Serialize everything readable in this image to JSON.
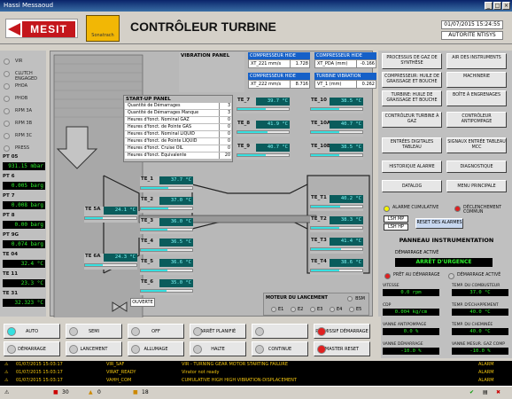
{
  "window": {
    "title": "Hassi Messaoud"
  },
  "header": {
    "logo_text": "MESIT",
    "logo2_text": "Sonatrach",
    "title": "CONTRÔLEUR TURBINE",
    "datetime": "01/07/2015 15:24:55",
    "user": "AUTORITE NTISYS"
  },
  "left_indicators": [
    {
      "label": "VIR"
    },
    {
      "label": "CLUTCH ENGAGED"
    },
    {
      "label": "PHOA"
    },
    {
      "label": "PHOB"
    },
    {
      "label": "RPM 3A"
    },
    {
      "label": "RPM 3B"
    },
    {
      "label": "RPM 3C"
    },
    {
      "label": "PRESS"
    }
  ],
  "pressures": [
    {
      "label": "PT 05",
      "value": "931.15 mbar"
    },
    {
      "label": "PT 6",
      "value": "0.005 barg"
    },
    {
      "label": "PT 7",
      "value": "0.008 barg"
    },
    {
      "label": "PT 8",
      "value": "0.00 barg"
    },
    {
      "label": "PT 9G",
      "value": "0.074 barg"
    },
    {
      "label": "TE 04",
      "value": "32.4 °C"
    },
    {
      "label": "TE 11",
      "value": "23.3 °C"
    },
    {
      "label": "TE 31",
      "value": "32.323 °C"
    }
  ],
  "vibration_panel": {
    "title": "VIBRATION PANEL",
    "items": [
      {
        "header": "COMPRESSEUR HIDE",
        "tag": "XT_221 mm/s",
        "value": "1.728"
      },
      {
        "header": "COMPRESSEUR HIDE",
        "tag": "XT_PDA (mm)",
        "value": "-0.166"
      },
      {
        "header": "COMPRESSEUR HIDE",
        "tag": "XT_222 mm/s",
        "value": "8.716"
      },
      {
        "header": "TURBINE VIBRATION",
        "tag": "VT_1 (mm)",
        "value": "0.262"
      }
    ]
  },
  "startup_panel": {
    "title": "START-UP PANEL",
    "rows": [
      {
        "label": "Quantité de Démarrages",
        "value": "3"
      },
      {
        "label": "Quantité de Démarrages Manque",
        "value": "3"
      },
      {
        "label": "Heures d'fonct. Nominal GAZ",
        "value": "0"
      },
      {
        "label": "Heures d'fonct. de Pointe GAS",
        "value": "0"
      },
      {
        "label": "Heures d'fonct. Nominal LIQUID",
        "value": "0"
      },
      {
        "label": "Heures d'fonct. de Pointe LIQUID",
        "value": "0"
      },
      {
        "label": "Heures d'fonct. Cruise OIL",
        "value": "0"
      },
      {
        "label": "Heures d'fonct. Equivalente",
        "value": "20"
      }
    ]
  },
  "temperatures": [
    {
      "label": "TE_7",
      "value": "39.7 °C",
      "fill": 0.55
    },
    {
      "label": "TE_10",
      "value": "38.5 °C",
      "fill": 0.55
    },
    {
      "label": "TE_8",
      "value": "41.9 °C",
      "fill": 0.58
    },
    {
      "label": "TE_10A",
      "value": "40.7 °C",
      "fill": 0.56
    },
    {
      "label": "TE_9",
      "value": "40.7 °C",
      "fill": 0.56
    },
    {
      "label": "TE_10B",
      "value": "38.5 °C",
      "fill": 0.55
    },
    {
      "label": "TE_1",
      "value": "37.7 °C",
      "fill": 0.54
    },
    {
      "label": "TE_2",
      "value": "37.0 °C",
      "fill": 0.53
    },
    {
      "label": "TE_3",
      "value": "36.0 °C",
      "fill": 0.52
    },
    {
      "label": "TE_4",
      "value": "36.5 °C",
      "fill": 0.52
    },
    {
      "label": "TE_5",
      "value": "36.6 °C",
      "fill": 0.52
    },
    {
      "label": "TE_6",
      "value": "35.0 °C",
      "fill": 0.5
    },
    {
      "label": "TE 5A",
      "value": "24.1 °C",
      "fill": 0.35
    },
    {
      "label": "TE 6A",
      "value": "24.3 °C",
      "fill": 0.35
    },
    {
      "label": "TE_T1",
      "value": "40.2 °C",
      "fill": 0.57
    },
    {
      "label": "TE_T2",
      "value": "38.3 °C",
      "fill": 0.55
    },
    {
      "label": "TE_T3",
      "value": "41.4 °C",
      "fill": 0.58
    },
    {
      "label": "TE_T4",
      "value": "38.6 °C",
      "fill": 0.55
    }
  ],
  "machine": {
    "ouverte": "OUVERTE",
    "moteur_title": "MOTEUR DU LANCEMENT",
    "moteur_items": [
      "E1",
      "E2",
      "E3",
      "E4",
      "E5"
    ],
    "bsm": "BSM"
  },
  "nav_buttons": [
    "PROCESSUS DE GAZ DE SYNTHÈSE",
    "AIR DES INSTRUMENTS",
    "COMPRESSEUR: HUILE DE GRAISSAGE ET BOUCHE",
    "MACHINERIE",
    "TURBINE: HUILE DE GRAISSAGE ET BOUCHE",
    "BOÎTE À ENGRENAGES",
    "CONTRÔLEUR TURBINE À GAZ",
    "CONTRÔLEUR ANTIPOMPAGE",
    "ENTRÉES DIGITALES TABLEAU",
    "SIGNAUX ENTRÉE TABLEAU MCC",
    "HISTORIQUE ALARME",
    "DIAGNOSTIQUE",
    "DATALOG",
    "MENU PRINCIPALE"
  ],
  "alarm_indicators": {
    "cumulative": "ALARME CUMULATIVE",
    "declenchement": "DÉCLENCHEMENT COMMUN",
    "lsh_mp": "LSH MP",
    "lsh_hp": "LSH HP",
    "reset": "RESET DES ALARMES"
  },
  "instrument_panel": {
    "title": "PANNEAU INSTRUMENTATION",
    "startup_label": "DÉMARRAGE ACTIVÉ",
    "startup_state": "ARRÊT D'URGENCE",
    "pret": "PRÊT AU DÉMARRAGE",
    "demarrage_active": "DÉMARRAGE ACTIVÉ",
    "readings": [
      {
        "label": "VITESSE",
        "value": "0.0 rpm"
      },
      {
        "label": "TEMP. DU COMBUSTEUR",
        "value": "37.0 °C"
      },
      {
        "label": "CDP",
        "value": "0.004 kg/cm"
      },
      {
        "label": "TEMP. D'ÉCHAPPEMENT",
        "value": "40.0 °C"
      },
      {
        "label": "VANNE ANTIPOMPAGE",
        "value": "0.0 %"
      },
      {
        "label": "TEMP. DU CHEMINÉE",
        "value": "40.0 °C"
      },
      {
        "label": "VANNE DÉMARRAGE",
        "value": "-10.0 %"
      },
      {
        "label": "VANNE MESUR. GAZ COMP",
        "value": "-10.0 %"
      }
    ]
  },
  "bottom_buttons": [
    {
      "label": "AUTO",
      "led": "#35e0e0"
    },
    {
      "label": "SEMI",
      "led": "#c8c8c8"
    },
    {
      "label": "OFF",
      "led": "#c8c8c8"
    },
    {
      "label": "ARRÊT PLANIFIÉ",
      "led": "#c8c8c8"
    },
    {
      "label": "",
      "led": "#c8c8c8"
    },
    {
      "label": "PERMISSIF DÉMARRAGE",
      "led": "#e02020"
    },
    {
      "label": "DÉMARRAGE",
      "led": "#c8c8c8"
    },
    {
      "label": "LANCEMENT",
      "led": "#c8c8c8"
    },
    {
      "label": "ALLUMAGE",
      "led": "#c8c8c8"
    },
    {
      "label": "HALTE",
      "led": "#c8c8c8"
    },
    {
      "label": "CONTINUE",
      "led": "#c8c8c8"
    },
    {
      "label": "MASTER RESET",
      "led": "#e02020"
    }
  ],
  "alarm_log": [
    {
      "time": "01/07/2015 15:03:17",
      "tag": "VIR_SAF",
      "msg": "VIR - TURNING GEAR MOTOR STARTING FAILURE",
      "type": "ALARM"
    },
    {
      "time": "01/07/2015 15:03:17",
      "tag": "VIRAT_READY",
      "msg": "Virator not ready",
      "type": "ALARM"
    },
    {
      "time": "01/07/2015 15:03:17",
      "tag": "VAHH_COM",
      "msg": "CUMULATIVE HIGH HIGH VIBRATION-DISPLACEMENT",
      "type": "ALARM"
    }
  ],
  "status_bar": {
    "alarms": "30",
    "warnings": "0",
    "events": "18"
  }
}
